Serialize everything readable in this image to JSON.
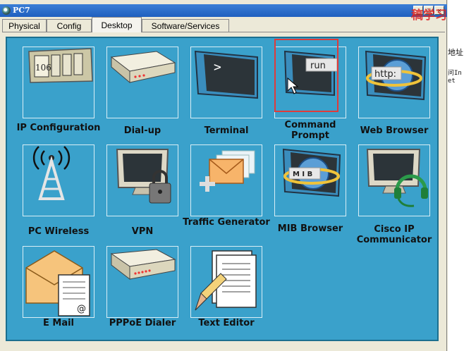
{
  "window": {
    "title": "PC7",
    "buttons": {
      "minimize": "_",
      "maximize": "□",
      "close": "×"
    }
  },
  "tabs": [
    {
      "label": "Physical"
    },
    {
      "label": "Config"
    },
    {
      "label": "Desktop"
    },
    {
      "label": "Software/Services"
    }
  ],
  "active_tab": "Desktop",
  "apps": {
    "ip": {
      "label": "IP Configuration",
      "icon_text": "106"
    },
    "dialup": {
      "label": "Dial-up"
    },
    "terminal": {
      "label": "Terminal",
      "icon_text": ">"
    },
    "cmd": {
      "label": "Command Prompt",
      "icon_text": "run"
    },
    "web": {
      "label": "Web Browser",
      "icon_text": "http:"
    },
    "wireless": {
      "label": "PC Wireless"
    },
    "vpn": {
      "label": "VPN"
    },
    "traffic": {
      "label": "Traffic Generator"
    },
    "mib": {
      "label": "MIB Browser",
      "icon_text": "M I B"
    },
    "cisco": {
      "label": "Cisco IP Communicator"
    },
    "email": {
      "label": "E Mail",
      "icon_text": "@"
    },
    "pppoe": {
      "label": "PPPoE Dialer"
    },
    "text": {
      "label": "Text Editor"
    }
  },
  "side_panel": {
    "top_overlay": "稿学习",
    "line1": "地址",
    "line2": "问In",
    "line3": "et"
  },
  "colors": {
    "panel_bg": "#3aa1cb",
    "title_bar": "#1f5fbf",
    "highlight": "#e03a3a"
  }
}
